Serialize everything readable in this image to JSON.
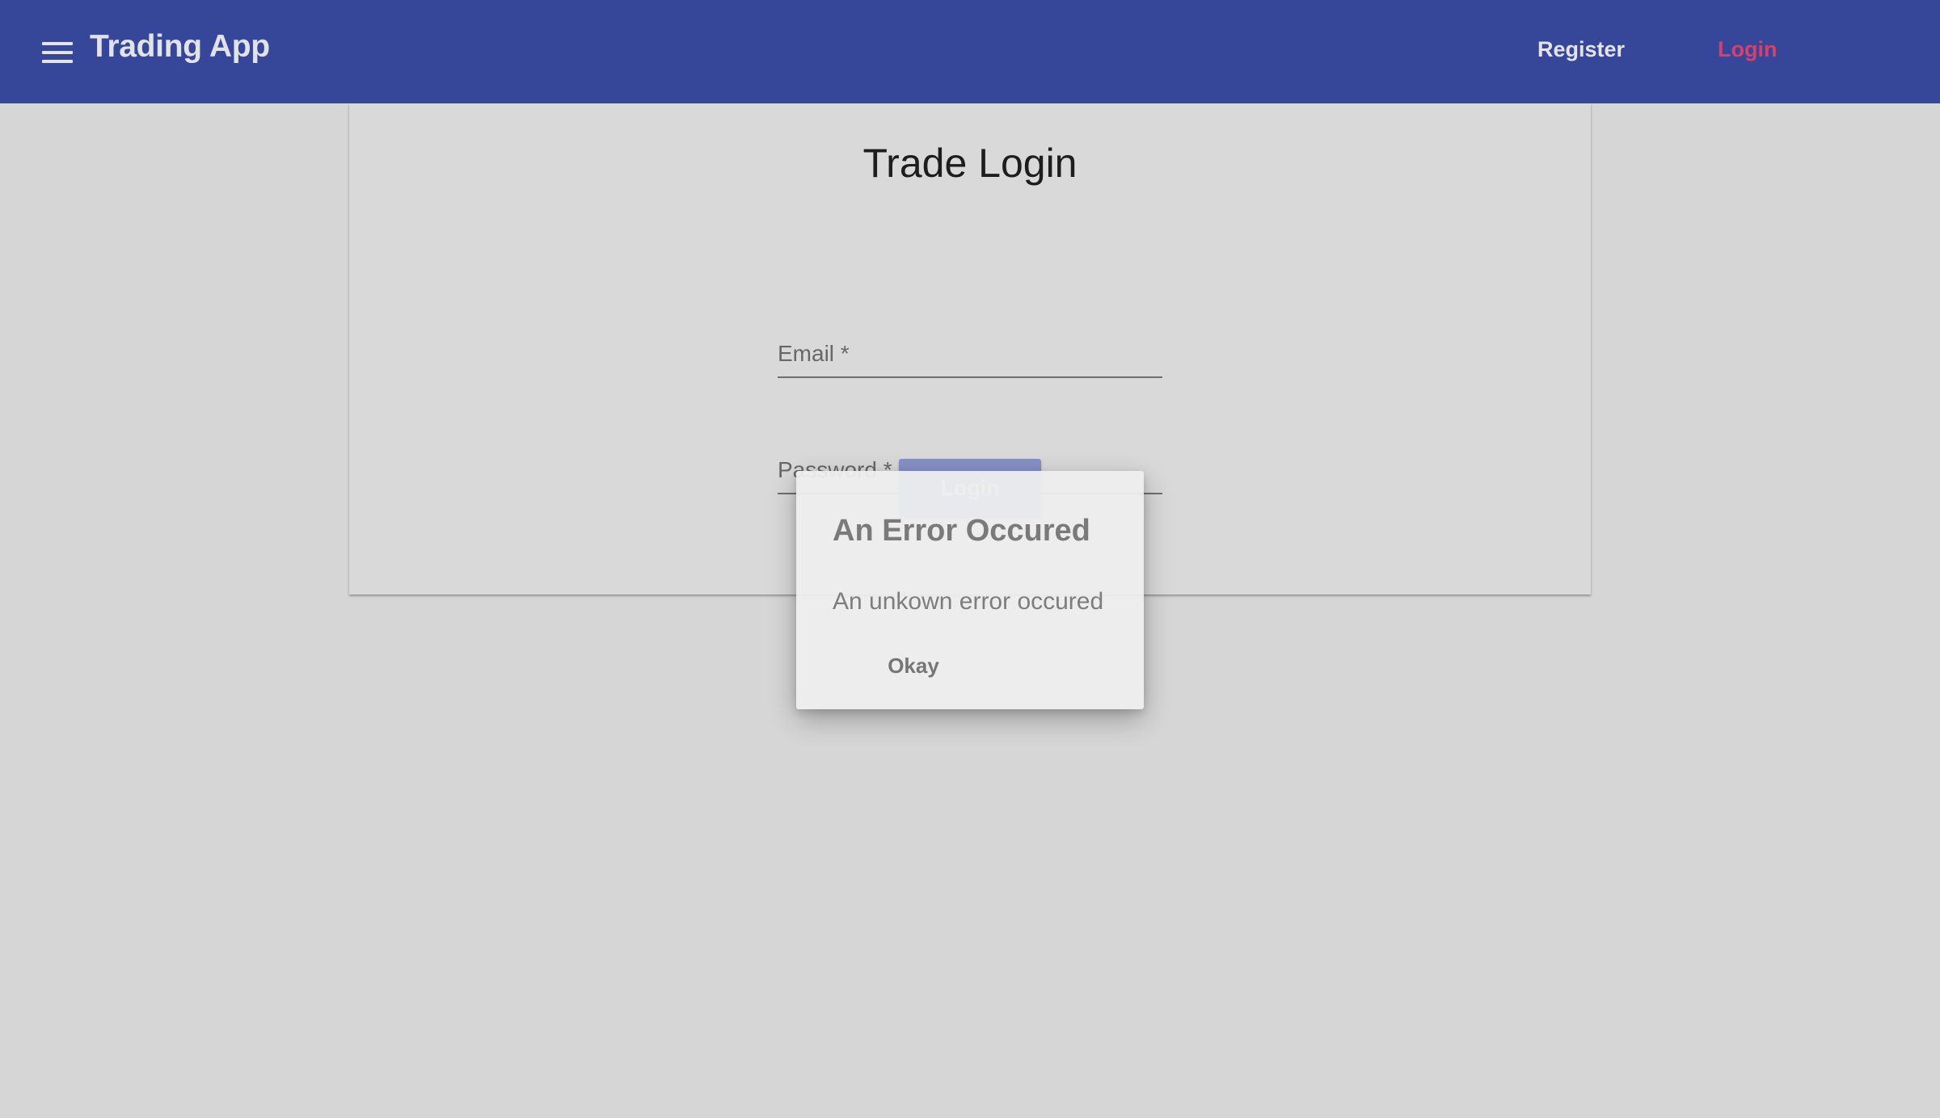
{
  "header": {
    "app_title": "Trading App",
    "nav": {
      "register_label": "Register",
      "login_label": "Login"
    },
    "icons": {
      "menu": "menu-icon"
    },
    "colors": {
      "toolbar": "#36479a",
      "active_nav": "#d83f6b"
    }
  },
  "login_form": {
    "title": "Trade Login",
    "email_label": "Email *",
    "password_label": "Password *",
    "submit_label": "Login"
  },
  "dialog": {
    "title": "An Error Occured",
    "message": "An unkown error occured",
    "ok_label": "Okay"
  }
}
